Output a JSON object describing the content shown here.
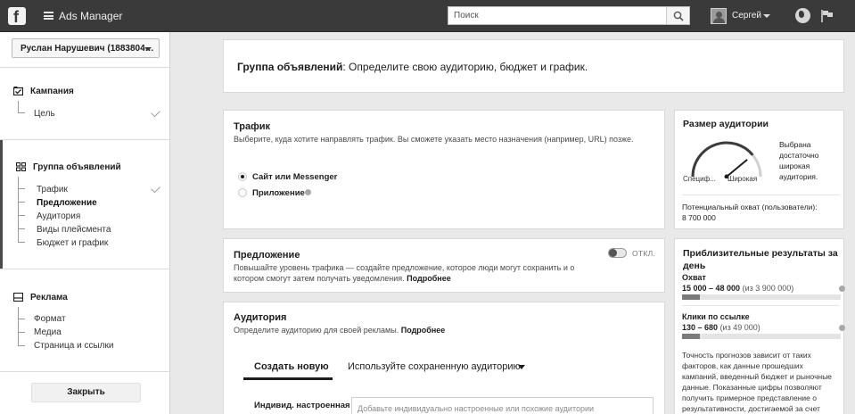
{
  "topbar": {
    "app_title": "Ads Manager",
    "search_placeholder": "Поиск",
    "user_name": "Сергей"
  },
  "sidebar": {
    "account": "Руслан Нарушевич (1883804…",
    "sections": [
      {
        "title": "Кампания",
        "items": [
          {
            "label": "Цель",
            "done": true
          }
        ]
      },
      {
        "title": "Группа объявлений",
        "items": [
          {
            "label": "Трафик",
            "done": true
          },
          {
            "label": "Предложение",
            "active": true
          },
          {
            "label": "Аудитория"
          },
          {
            "label": "Виды плейсмента"
          },
          {
            "label": "Бюджет и график"
          }
        ]
      },
      {
        "title": "Реклама",
        "items": [
          {
            "label": "Формат"
          },
          {
            "label": "Медиа"
          },
          {
            "label": "Страница и ссылки"
          }
        ]
      }
    ],
    "close_label": "Закрыть"
  },
  "header_card": {
    "title_bold": "Группа объявлений",
    "title_rest": ": Определите свою аудиторию, бюджет и график."
  },
  "traffic": {
    "title": "Трафик",
    "subtitle": "Выберите, куда хотите направлять трафик. Вы сможете указать место назначения (например, URL) позже.",
    "options": [
      {
        "label": "Сайт или Messenger",
        "selected": true
      },
      {
        "label": "Приложение",
        "selected": false
      }
    ]
  },
  "offer": {
    "title": "Предложение",
    "toggle_label": "ОТКЛ.",
    "text_line1": "Повышайте уровень трафика — создайте предложение, которое люди могут сохранить и о",
    "text_line2": "котором смогут затем получать уведомления.",
    "more": "Подробнее"
  },
  "audience": {
    "title": "Аудитория",
    "subtitle": "Определите аудиторию для своей рекламы.",
    "more": "Подробнее",
    "tabs": [
      {
        "label": "Создать новую",
        "active": true
      },
      {
        "label": "Используйте сохраненную аудиторию",
        "dropdown": true
      }
    ],
    "custom_label": "Индивид. настроенная",
    "custom_placeholder": "Добавьте индивидуально настроенные или похожие аудитории"
  },
  "audience_size": {
    "title": "Размер аудитории",
    "gauge_left": "Специф...",
    "gauge_right": "Широкая",
    "gauge_level": 0.78,
    "status_lines": [
      "Выбрана",
      "достаточно",
      "широкая",
      "аудитория."
    ],
    "potential_label": "Потенциальный охват (пользователи):",
    "potential_value": "8 700 000"
  },
  "daily_results": {
    "title_line1": "Приблизительные результаты за",
    "title_line2": "день",
    "reach_label": "Охват",
    "reach_value": "15 000 – 48 000",
    "reach_of": "(из 3 900 000)",
    "reach_fill": 0.11,
    "clicks_label": "Клики по ссылке",
    "clicks_value": "130 – 680",
    "clicks_of": "(из 49 000)",
    "clicks_fill": 0.11,
    "note_lines": [
      "Точность прогнозов зависит от таких",
      "факторов, как данные прошедших",
      "кампаний, введенный бюджет и рыночные",
      "данные. Показанные цифры позволяют",
      "получить примерное представление о",
      "результативности, достигаемой за счет"
    ]
  },
  "colors": {
    "topbar": "#3a3a3a",
    "page_bg": "#e9e9e9",
    "card_bg": "#ffffff"
  }
}
